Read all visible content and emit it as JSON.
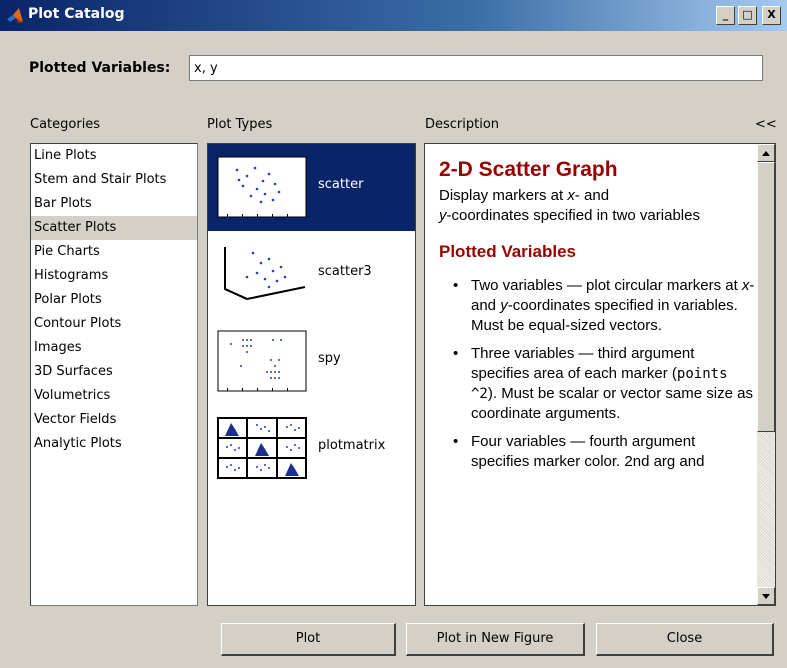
{
  "window": {
    "title": "Plot Catalog",
    "controls": {
      "minimize": "_",
      "maximize": "□",
      "close": "X"
    }
  },
  "plotted_variables": {
    "label": "Plotted Variables:",
    "value": "x, y"
  },
  "columns": {
    "categories": "Categories",
    "plot_types": "Plot Types",
    "description": "Description",
    "collapse": "<<"
  },
  "categories": [
    "Line Plots",
    "Stem and Stair Plots",
    "Bar Plots",
    "Scatter Plots",
    "Pie Charts",
    "Histograms",
    "Polar Plots",
    "Contour Plots",
    "Images",
    "3D Surfaces",
    "Volumetrics",
    "Vector Fields",
    "Analytic Plots"
  ],
  "selected_category": "Scatter Plots",
  "plot_types": [
    {
      "label": "scatter",
      "icon": "scatter-thumbnail",
      "selected": true
    },
    {
      "label": "scatter3",
      "icon": "scatter3-thumbnail",
      "selected": false
    },
    {
      "label": "spy",
      "icon": "spy-thumbnail",
      "selected": false
    },
    {
      "label": "plotmatrix",
      "icon": "plotmatrix-thumbnail",
      "selected": false
    }
  ],
  "description": {
    "title": "2-D Scatter Graph",
    "summary_a": "Display markers at ",
    "summary_x": "x",
    "summary_b": "- and",
    "summary_y": "y",
    "summary_c": "-coordinates specified in two variables",
    "section": "Plotted Variables",
    "bullet1_a": "Two variables — plot circular markers at ",
    "bullet1_x": "x",
    "bullet1_b": "- and ",
    "bullet1_y": "y",
    "bullet1_c": "-coordinates specified in variables. Must be equal-sized vectors.",
    "bullet2_a": "Three variables — third argument specifies area of each marker (",
    "bullet2_code": "points ^2",
    "bullet2_b": "). Must be scalar or vector same size as coordinate arguments.",
    "bullet3": "Four variables — fourth argument specifies marker color. 2nd arg and"
  },
  "buttons": {
    "plot": "Plot",
    "plot_new_figure": "Plot in New Figure",
    "close": "Close"
  },
  "colors": {
    "accent_red": "#990000",
    "selection_blue": "#0a246a",
    "dialog_gray": "#d4d0c8"
  }
}
